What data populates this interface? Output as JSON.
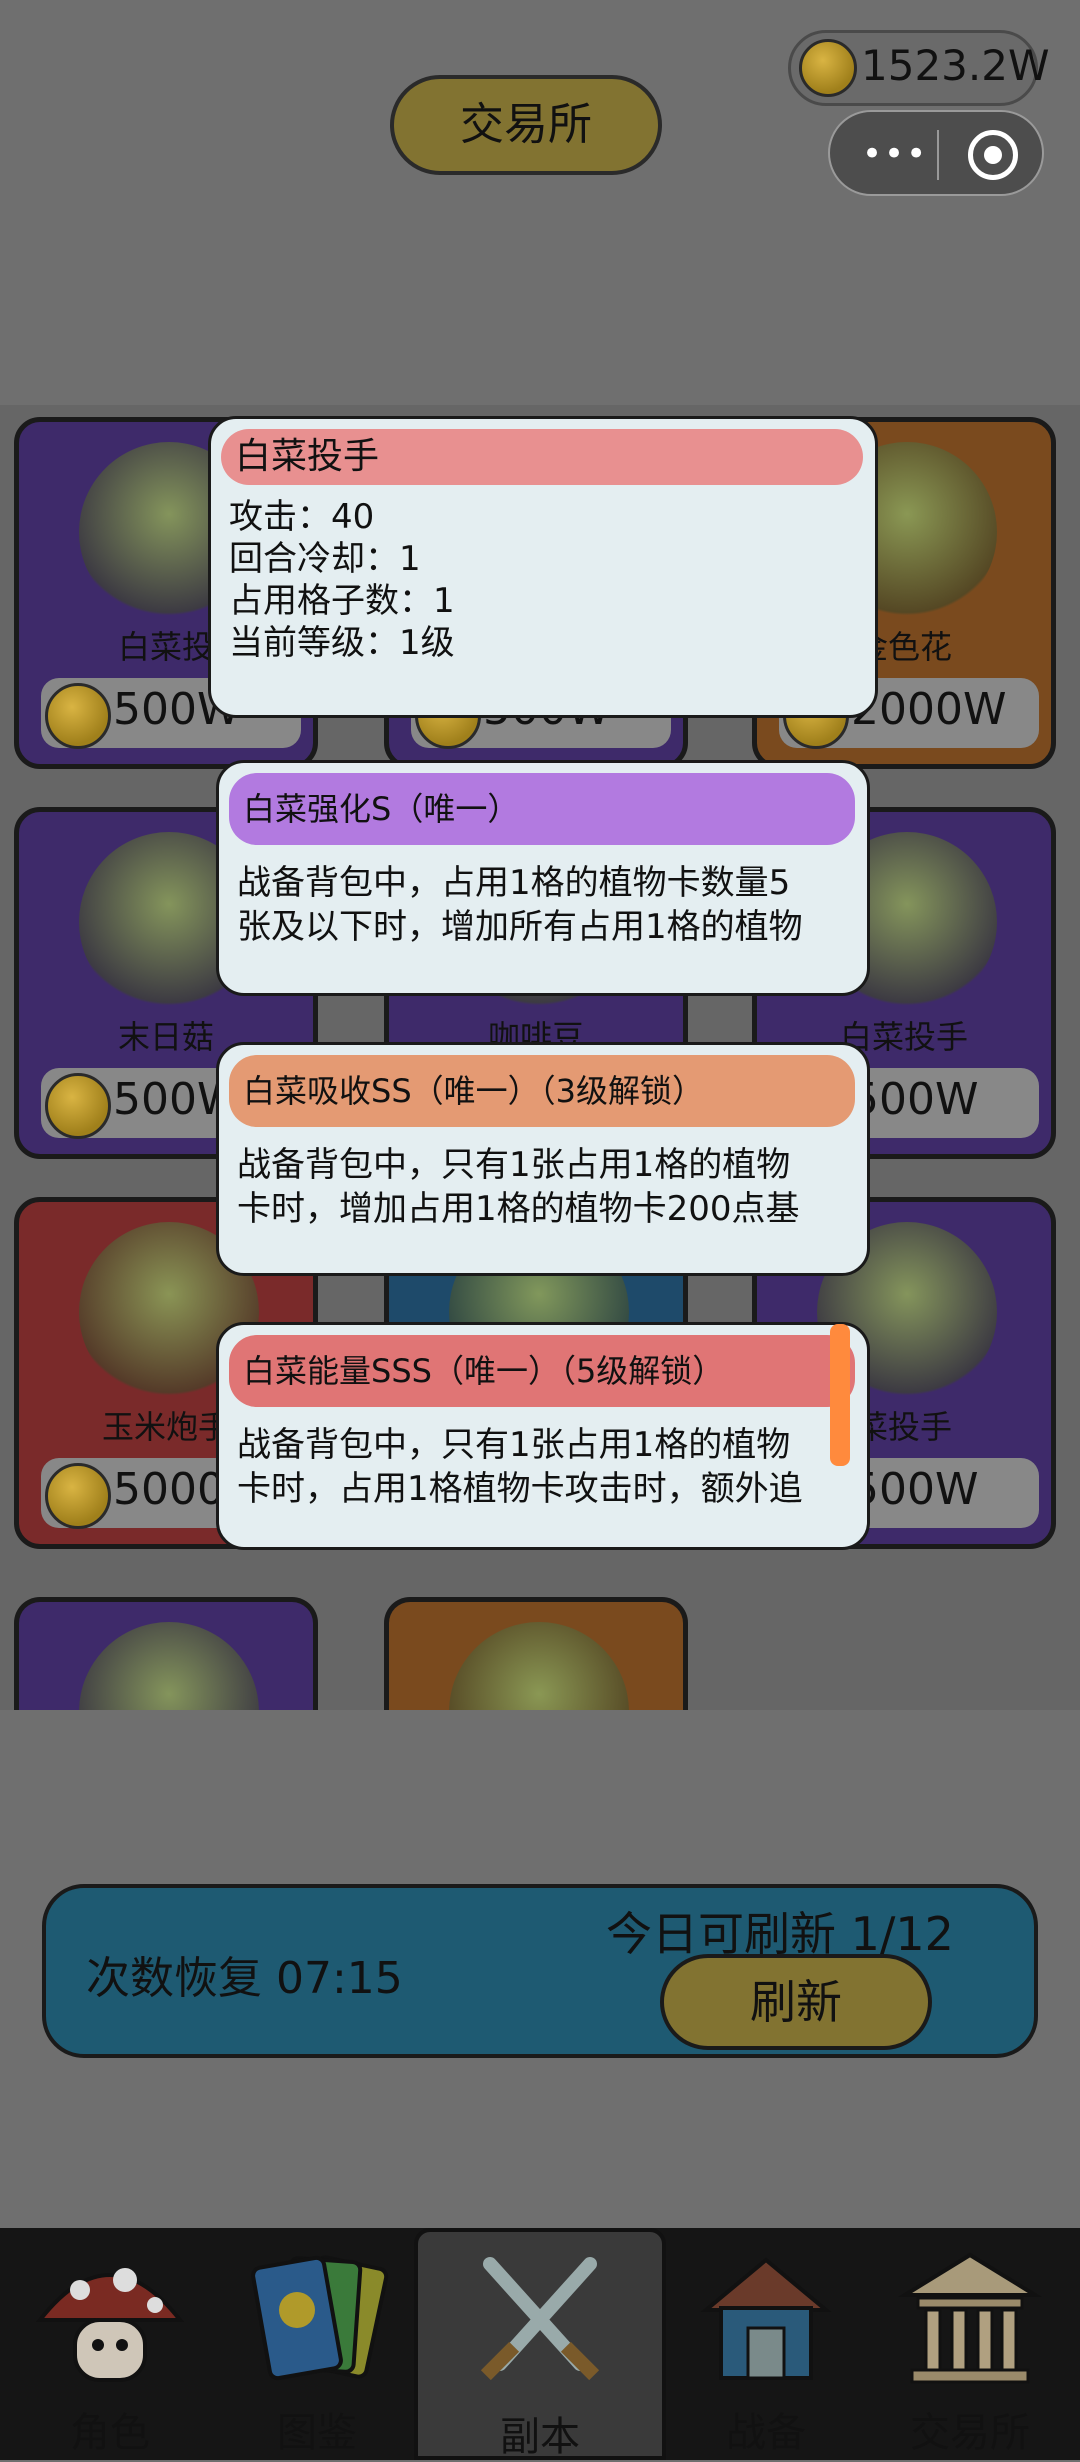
{
  "header": {
    "title": "交易所",
    "coins": "1523.2W"
  },
  "cards": [
    {
      "name": "白菜投",
      "price": "500W",
      "color": "purple"
    },
    {
      "name": "",
      "price": "500W",
      "color": "purple"
    },
    {
      "name": "金色花",
      "price": "2000W",
      "color": "orange"
    },
    {
      "name": "末日菇",
      "price": "500W",
      "color": "purple"
    },
    {
      "name": "咖啡豆",
      "price": "",
      "color": "purple"
    },
    {
      "name": "白菜投手",
      "price": "500W",
      "color": "purple"
    },
    {
      "name": "玉米炮手",
      "price": "5000",
      "color": "red"
    },
    {
      "name": "",
      "price": "",
      "color": "blue"
    },
    {
      "name": "菜投手",
      "price": "500W",
      "color": "purple"
    },
    {
      "name": "",
      "price": "",
      "color": "purple"
    },
    {
      "name": "",
      "price": "",
      "color": "orange"
    }
  ],
  "popup_main": {
    "title": "白菜投手",
    "attack": "攻击：40",
    "cooldown": "回合冷却：1",
    "slots": "占用格子数：1",
    "level": "当前等级：1级"
  },
  "skills": [
    {
      "title": "白菜强化S（唯一）",
      "line1": "战备背包中，占用1格的植物卡数量5",
      "line2": "张及以下时，增加所有占用1格的植物"
    },
    {
      "title": "白菜吸收SS（唯一）（3级解锁）",
      "line1": "战备背包中，只有1张占用1格的植物",
      "line2": "卡时，增加占用1格的植物卡200点基"
    },
    {
      "title": "白菜能量SSS（唯一）（5级解锁）",
      "line1": "战备背包中，只有1张占用1格的植物",
      "line2": "卡时，占用1格植物卡攻击时，额外追"
    }
  ],
  "status": {
    "recover": "次数恢复 07:15",
    "refresh_count": "今日可刷新 1/12",
    "refresh_button": "刷新"
  },
  "nav": [
    {
      "label": "角色",
      "icon": "mushroom-icon"
    },
    {
      "label": "图鉴",
      "icon": "cards-icon"
    },
    {
      "label": "副本",
      "icon": "crossed-swords-icon"
    },
    {
      "label": "战备",
      "icon": "house-icon"
    },
    {
      "label": "交易所",
      "icon": "bank-icon"
    }
  ],
  "colors": {
    "gold": "#827331",
    "teal": "#1e5a72"
  }
}
